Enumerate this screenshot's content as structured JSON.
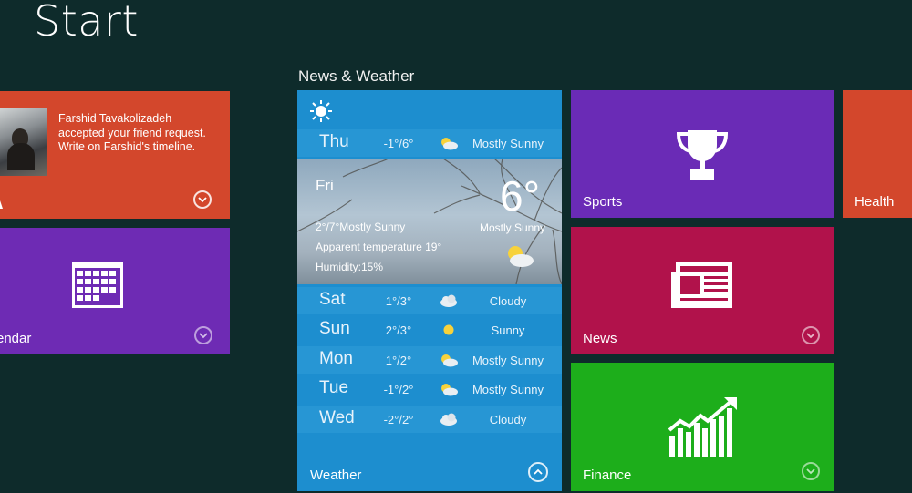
{
  "screen": {
    "title": "Start"
  },
  "group": {
    "title": "News & Weather"
  },
  "social": {
    "message": "Farshid Tavakolizadeh accepted your friend request. Write on Farshid's timeline."
  },
  "calendar": {
    "label": "endar"
  },
  "weather": {
    "label": "Weather",
    "today_row": {
      "day": "Thu",
      "temp": "-1°/6°",
      "icon": "partly-sunny-icon",
      "condition": "Mostly Sunny"
    },
    "current": {
      "day": "Fri",
      "temp": "6°",
      "condition": "Mostly Sunny",
      "range": "2°/7°Mostly Sunny",
      "apparent": "Apparent temperature 19°",
      "humidity": "Humidity:15%"
    },
    "forecast": [
      {
        "day": "Sat",
        "temp": "1°/3°",
        "icon": "cloudy-icon",
        "condition": "Cloudy"
      },
      {
        "day": "Sun",
        "temp": "2°/3°",
        "icon": "sunny-icon",
        "condition": "Sunny"
      },
      {
        "day": "Mon",
        "temp": "1°/2°",
        "icon": "partly-sunny-icon",
        "condition": "Mostly Sunny"
      },
      {
        "day": "Tue",
        "temp": "-1°/2°",
        "icon": "partly-sunny-icon",
        "condition": "Mostly Sunny"
      },
      {
        "day": "Wed",
        "temp": "-2°/2°",
        "icon": "cloudy-icon",
        "condition": "Cloudy"
      }
    ]
  },
  "sports": {
    "label": "Sports"
  },
  "health": {
    "label": "Health"
  },
  "news": {
    "label": "News"
  },
  "finance": {
    "label": "Finance"
  },
  "colors": {
    "background": "#0e2b2b",
    "social": "#d3472c",
    "calendar": "#6e2bb4",
    "weather": "#1d8ecf",
    "sports": "#6a2bb6",
    "health": "#d3472c",
    "news": "#b1124b",
    "finance": "#1dae1b"
  }
}
